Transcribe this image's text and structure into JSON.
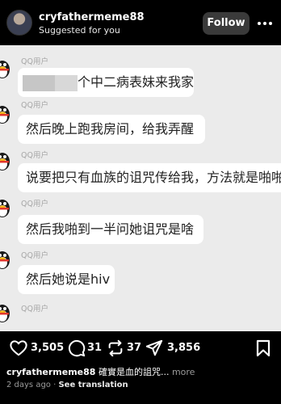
{
  "header": {
    "username": "cryfathermeme88",
    "subtitle": "Suggested for you",
    "follow_label": "Follow"
  },
  "chat": {
    "messages": [
      {
        "sender": "QQ用户",
        "text": "个中二病表妹来我家玩"
      },
      {
        "sender": "QQ用户",
        "text": "然后晚上跑我房间，给我弄醒"
      },
      {
        "sender": "QQ用户",
        "text": "说要把只有血族的诅咒传给我，方法就是啪啪"
      },
      {
        "sender": "QQ用户",
        "text": "然后我啪到一半问她诅咒是啥"
      },
      {
        "sender": "QQ用户",
        "text": "然后她说是hiv"
      },
      {
        "sender": "QQ用户",
        "text": ""
      }
    ]
  },
  "actions": {
    "likes": "3,505",
    "comments": "31",
    "reposts": "37",
    "shares": "3,856"
  },
  "caption": {
    "username": "cryfathermeme88",
    "text": "確實是血的詛咒...",
    "more": "more"
  },
  "meta": {
    "time": "2 days ago",
    "separator": "·",
    "see_translation": "See translation"
  },
  "icons": [
    "heart-icon",
    "comment-icon",
    "repost-icon",
    "share-icon",
    "bookmark-icon",
    "more-icon",
    "qq-penguin-icon"
  ]
}
